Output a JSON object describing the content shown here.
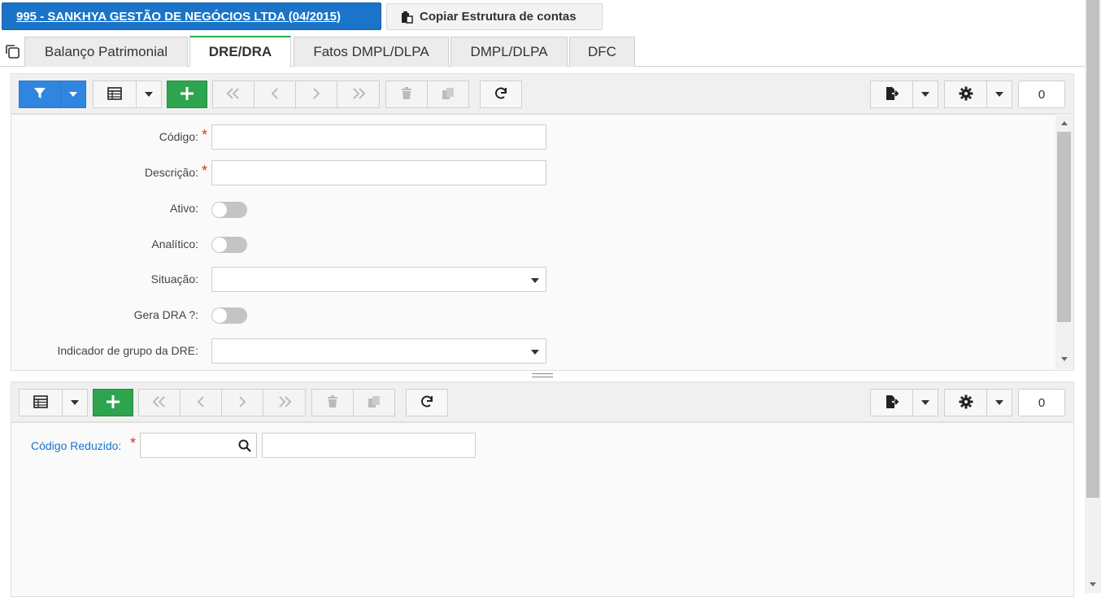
{
  "header": {
    "company_label": "995 - SANKHYA GESTÃO DE NEGÓCIOS LTDA (04/2015)",
    "copy_button_label": "Copiar Estrutura de contas"
  },
  "tabs": [
    {
      "label": "Balanço Patrimonial",
      "active": false
    },
    {
      "label": "DRE/DRA",
      "active": true
    },
    {
      "label": "Fatos DMPL/DLPA",
      "active": false
    },
    {
      "label": "DMPL/DLPA",
      "active": false
    },
    {
      "label": "DFC",
      "active": false
    }
  ],
  "toolbar_top": {
    "icons": [
      "filter-icon",
      "grid-icon",
      "plus-icon",
      "first-icon",
      "prev-icon",
      "next-icon",
      "last-icon",
      "trash-icon",
      "copy-icon",
      "refresh-icon",
      "export-icon",
      "gear-icon"
    ],
    "record_count": "0"
  },
  "form": {
    "codigo_label": "Código:",
    "descricao_label": "Descrição:",
    "ativo_label": "Ativo:",
    "analitico_label": "Analítico:",
    "situacao_label": "Situação:",
    "gera_dra_label": "Gera DRA ?:",
    "indicador_label": "Indicador de grupo da DRE:",
    "required_mark": "*",
    "codigo_value": "",
    "descricao_value": "",
    "situacao_value": "",
    "indicador_value": "",
    "ativo_on": false,
    "analitico_on": false,
    "gera_dra_on": false
  },
  "toolbar_bottom": {
    "record_count": "0"
  },
  "detail": {
    "codigo_reduzido_label": "Código Reduzido:",
    "required_mark": "*",
    "codigo_reduzido_value": "",
    "descricao_value": ""
  },
  "colors": {
    "primary_blue": "#1a74c9",
    "filter_blue": "#2f86e0",
    "add_green": "#2ea44f",
    "active_tab_accent": "#2eab4f",
    "required_red": "#d9342b",
    "link_blue": "#1a74c9"
  }
}
